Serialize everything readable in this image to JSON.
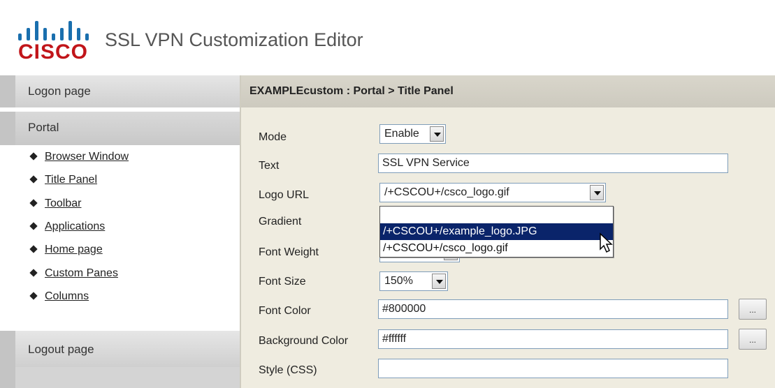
{
  "app": {
    "logo_text": "CISCO",
    "title": "SSL VPN Customization Editor"
  },
  "sidebar": {
    "sections": {
      "logon": "Logon page",
      "portal": "Portal",
      "logout": "Logout page"
    },
    "portal_items": [
      {
        "label": "Browser Window"
      },
      {
        "label": "Title Panel"
      },
      {
        "label": "Toolbar"
      },
      {
        "label": "Applications"
      },
      {
        "label": "Home page"
      },
      {
        "label": "Custom Panes"
      },
      {
        "label": "Columns"
      }
    ]
  },
  "main": {
    "breadcrumb": "EXAMPLEcustom : Portal > Title Panel",
    "fields": {
      "mode": {
        "label": "Mode",
        "value": "Enable"
      },
      "text": {
        "label": "Text",
        "value": "SSL VPN Service"
      },
      "logo_url": {
        "label": "Logo URL",
        "value": "/+CSCOU+/csco_logo.gif"
      },
      "gradient": {
        "label": "Gradient"
      },
      "font_weight": {
        "label": "Font Weight"
      },
      "font_size": {
        "label": "Font Size",
        "value": "150%"
      },
      "font_color": {
        "label": "Font Color",
        "value": "#800000"
      },
      "background_color": {
        "label": "Background Color",
        "value": "#ffffff"
      },
      "style_css": {
        "label": "Style (CSS)",
        "value": ""
      }
    },
    "logo_dropdown": {
      "options": [
        {
          "label": "/+CSCOU+/example_logo.JPG",
          "highlighted": true
        },
        {
          "label": "/+CSCOU+/csco_logo.gif",
          "highlighted": false
        }
      ]
    },
    "color_picker_button": "..."
  },
  "colors": {
    "cisco_blue": "#1a6fae",
    "cisco_red": "#c1151a",
    "highlight": "#0a246a",
    "panel_bg": "#efece0"
  }
}
